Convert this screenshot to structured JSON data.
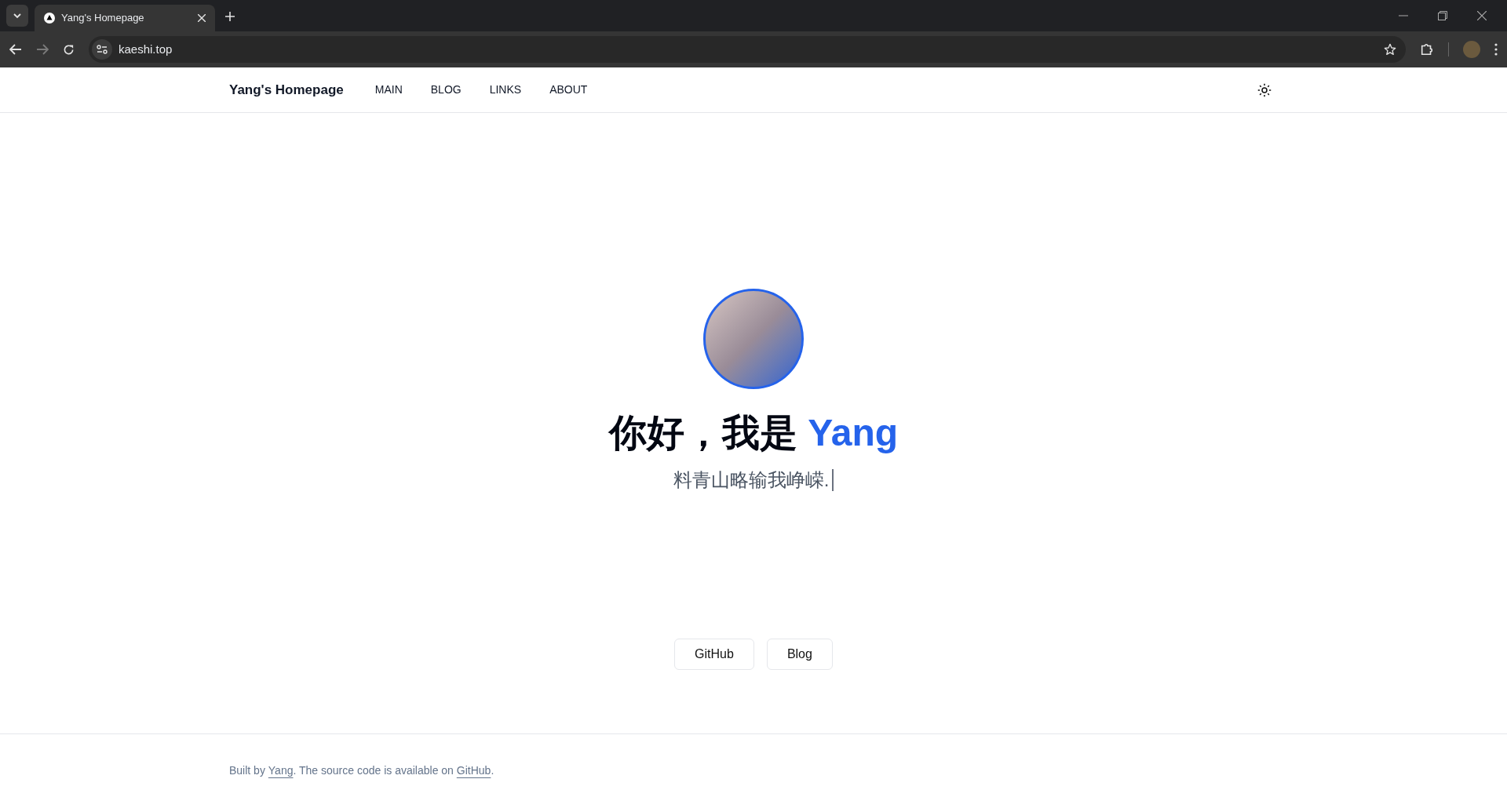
{
  "browser": {
    "tabs": [
      {
        "title": "Yang's Homepage",
        "selected": true
      }
    ],
    "address": "kaeshi.top",
    "forward_disabled": true
  },
  "header": {
    "site_title": "Yang's Homepage",
    "nav": [
      {
        "label": "MAIN"
      },
      {
        "label": "BLOG"
      },
      {
        "label": "LINKS"
      },
      {
        "label": "ABOUT"
      }
    ]
  },
  "hero": {
    "greeting": "你好，我是",
    "name": "Yang",
    "tagline": "料青山略输我峥嵘."
  },
  "buttons": [
    {
      "label": "GitHub"
    },
    {
      "label": "Blog"
    }
  ],
  "footer": {
    "before": "Built by ",
    "author_link": "Yang",
    "middle": ". The source code is available on ",
    "source_link": "GitHub",
    "after": "."
  }
}
